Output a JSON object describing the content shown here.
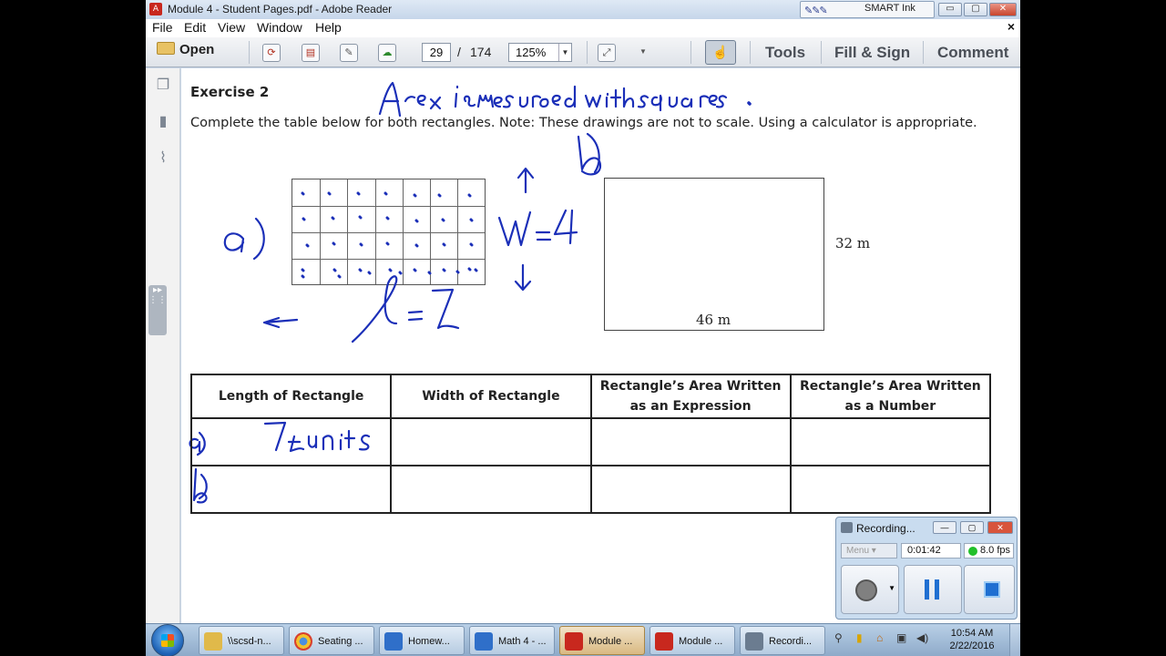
{
  "window": {
    "title": "Module 4 - Student Pages.pdf - Adobe Reader",
    "smart_ink": "SMART Ink",
    "min": "▭",
    "max": "▢",
    "close": "✕"
  },
  "menu": {
    "items": [
      "File",
      "Edit",
      "View",
      "Window",
      "Help"
    ],
    "close": "×"
  },
  "toolbar": {
    "open": "Open",
    "page_current": "29",
    "page_sep": "/",
    "page_total": "174",
    "zoom": "125%",
    "tools": "Tools",
    "fill_sign": "Fill & Sign",
    "comment": "Comment"
  },
  "document": {
    "exercise_title": "Exercise 2",
    "instructions": "Complete the table below for both rectangles.  Note:  These drawings are not to scale.  Using a calculator is appropriate.",
    "rect_b_height": "32 m",
    "rect_b_width": "46 m",
    "table_headers": [
      "Length of Rectangle",
      "Width of Rectangle",
      "Rectangle’s Area Written\nas an Expression",
      "Rectangle’s Area Written\nas a Number"
    ],
    "handwriting": {
      "note": "Area is measured with squares.",
      "label_a": "a)",
      "label_b": "b)",
      "width_note": "W=4",
      "length_note": "l=7",
      "row_a_label": "a)",
      "row_a_length": "7 units",
      "row_b_label": "b)"
    }
  },
  "recorder": {
    "title": "Recording...",
    "menu": "Menu",
    "time": "0:01:42",
    "fps": "8.0 fps"
  },
  "taskbar": {
    "items": [
      {
        "label": "\\\\scsd-n...",
        "color": "#e0b94a"
      },
      {
        "label": "Seating ...",
        "color": "#4a8fe0"
      },
      {
        "label": "Homew...",
        "color": "#2f6fc9"
      },
      {
        "label": "Math 4 - ...",
        "color": "#2f6fc9"
      },
      {
        "label": "Module ...",
        "color": "#c8281e"
      },
      {
        "label": "Module ...",
        "color": "#c8281e"
      },
      {
        "label": "Recordi...",
        "color": "#6b7c90"
      }
    ],
    "time": "10:54 AM",
    "date": "2/22/2016"
  },
  "colors": {
    "ink": "#1b2fb8",
    "adobe_red": "#c8281e"
  }
}
